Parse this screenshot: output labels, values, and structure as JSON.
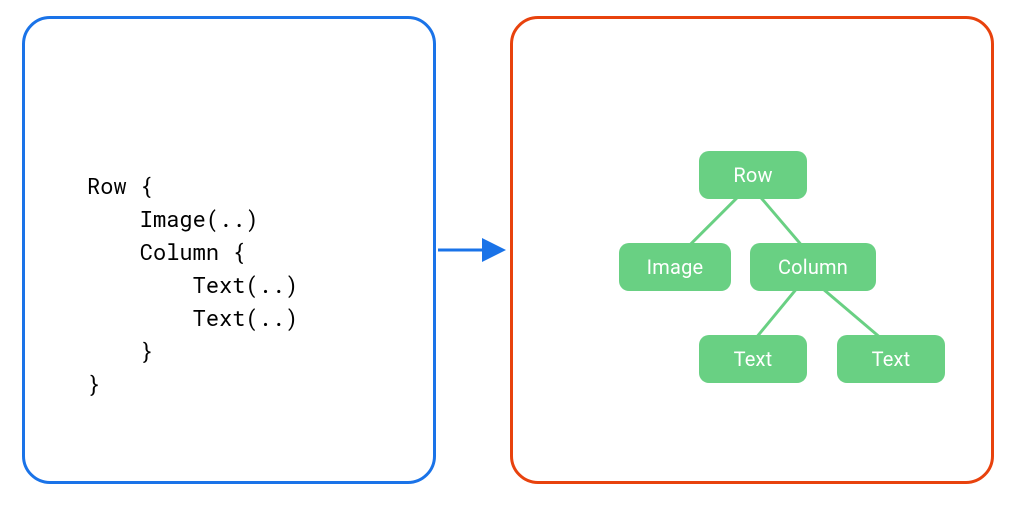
{
  "colors": {
    "blue_border": "#1a73e8",
    "orange_border": "#e8420d",
    "arrow": "#1a73e8",
    "node_bg": "#69d083",
    "node_text": "#ffffff",
    "edge": "#69d083"
  },
  "code": "Row {\n    Image(..)\n    Column {\n        Text(..)\n        Text(..)\n    }\n}",
  "tree": {
    "root": {
      "label": "Row"
    },
    "left": {
      "label": "Image"
    },
    "right": {
      "label": "Column"
    },
    "right_left": {
      "label": "Text"
    },
    "right_right": {
      "label": "Text"
    }
  }
}
